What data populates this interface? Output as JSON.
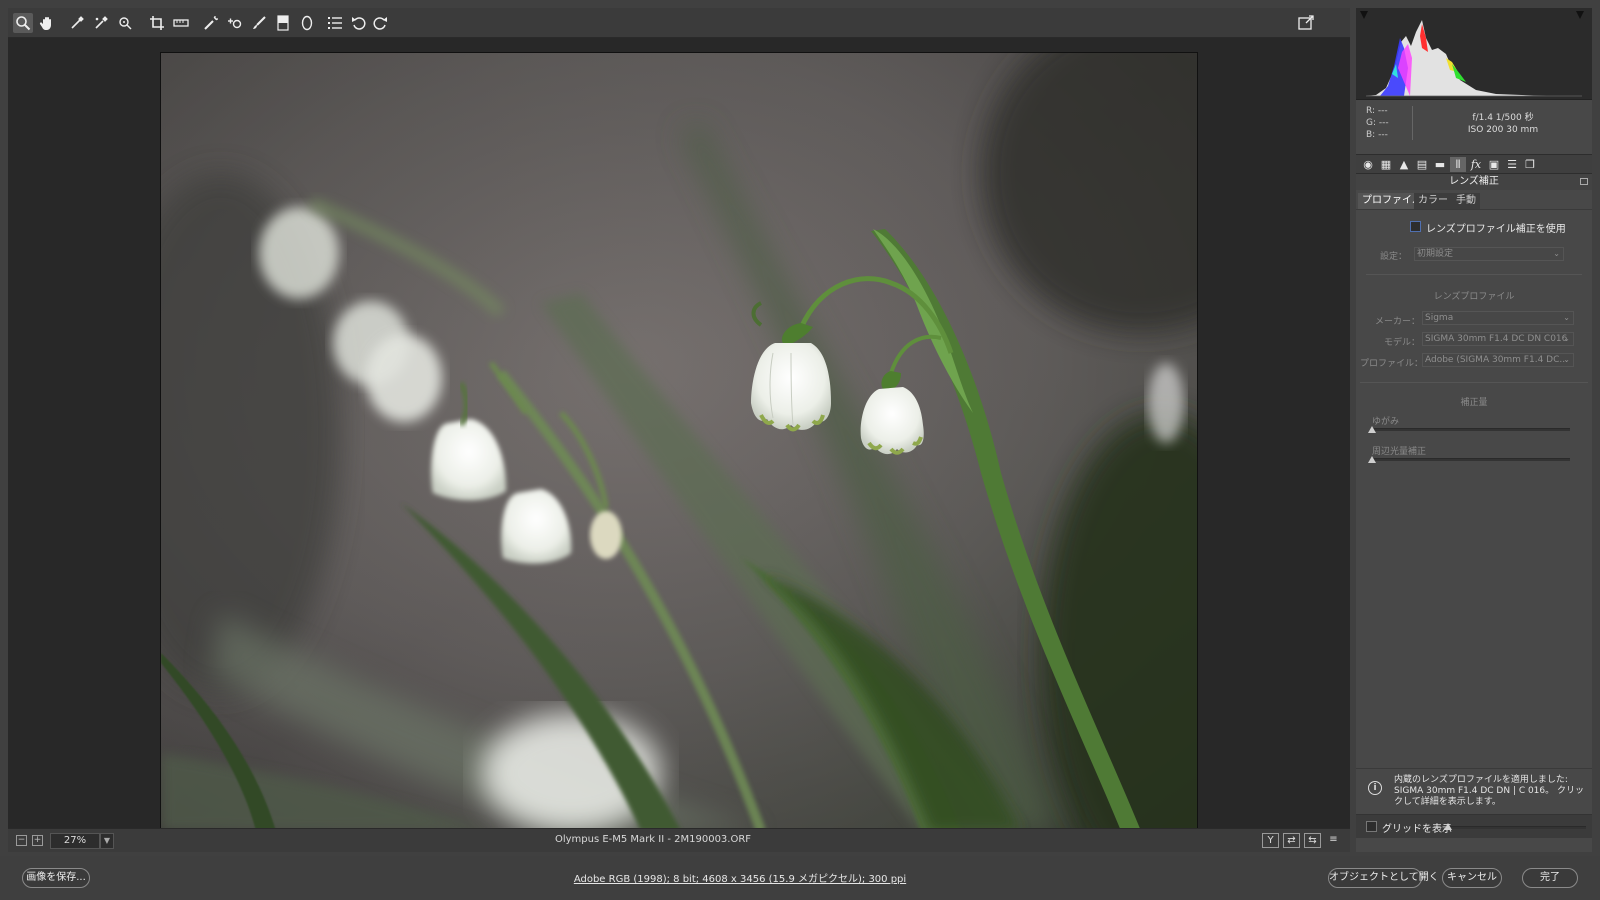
{
  "toolbar": {
    "tools": [
      "zoom-icon",
      "hand-icon",
      "white-balance-icon",
      "color-sampler-icon",
      "target-adjust-icon",
      "crop-icon",
      "straighten-icon",
      "spot-removal-icon",
      "red-eye-icon",
      "adjustment-brush-icon",
      "graduated-filter-icon",
      "radial-filter-icon",
      "preferences-icon",
      "rotate-left-icon",
      "rotate-right-icon"
    ],
    "fullscreen_icon": "fullscreen-icon"
  },
  "status": {
    "zoom": "27%",
    "filename": "Olympus E-M5 Mark II  -  2M190003.ORF",
    "view_buttons": [
      "Y",
      "⇄",
      "⇆",
      "≡"
    ]
  },
  "readout": {
    "r": "R:   ---",
    "g": "G:   ---",
    "b": "B:   ---",
    "exif_line1": "f/1.4    1/500 秒",
    "exif_line2": "ISO 200    30 mm"
  },
  "panel": {
    "title": "レンズ補正",
    "tabs": [
      "プロファイル",
      "カラー",
      "手動"
    ],
    "use_profile_label": "レンズプロファイル補正を使用",
    "setup_label": "設定：",
    "setup_value": "初期設定",
    "profile_section": "レンズプロファイル",
    "make_label": "メーカー：",
    "make_value": "Sigma",
    "model_label": "モデル：",
    "model_value": "SIGMA 30mm F1.4 DC DN C016",
    "profile_label": "プロファイル：",
    "profile_value": "Adobe (SIGMA 30mm F1.4 DC...",
    "amount_section": "補正量",
    "distortion_label": "ゆがみ",
    "vignetting_label": "周辺光量補正",
    "notice": "内蔵のレンズプロファイルを適用しました: SIGMA 30mm F1.4 DC DN | C 016。 クリックして詳細を表示します。",
    "grid_label": "グリッドを表示"
  },
  "bottom": {
    "save_button": "画像を保存...",
    "workflow_link": "Adobe RGB (1998); 8 bit; 4608 x 3456 (15.9 メガピクセル); 300 ppi",
    "open_object_button": "オブジェクトとして開く",
    "cancel_button": "キャンセル",
    "done_button": "完了"
  },
  "colors": {
    "accent": "#5070b0",
    "panel_bg": "#484848",
    "workspace_bg": "#282828"
  }
}
